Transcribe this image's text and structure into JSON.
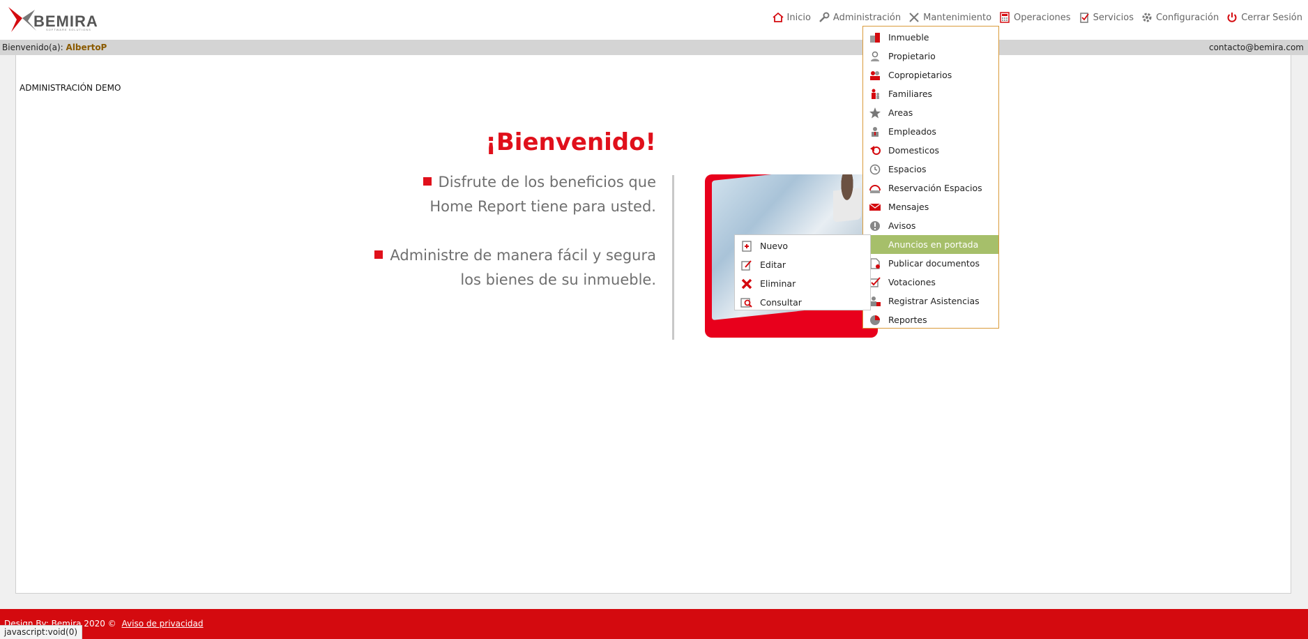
{
  "header": {
    "logo_text": "BEMIRA",
    "logo_sub": "SOFTWARE SOLUTIONS",
    "nav": [
      {
        "label": "Inicio",
        "icon": "home-icon"
      },
      {
        "label": "Administración",
        "icon": "wrench-icon"
      },
      {
        "label": "Mantenimiento",
        "icon": "tools-icon"
      },
      {
        "label": "Operaciones",
        "icon": "calculator-icon"
      },
      {
        "label": "Servicios",
        "icon": "clipboard-icon"
      },
      {
        "label": "Configuración",
        "icon": "gear-icon"
      },
      {
        "label": "Cerrar Sesión",
        "icon": "power-icon"
      }
    ]
  },
  "welcome_bar": {
    "prefix": "Bienvenido(a):",
    "user": "AlbertoP",
    "email": "contacto@bemira.com"
  },
  "content": {
    "admin_title": "ADMINISTRACIÓN DEMO",
    "heading": "¡Bienvenido!",
    "text1_line1": "Disfrute de los beneficios que",
    "text1_line2": "Home Report tiene para usted.",
    "text2_line1": "Administre de manera fácil y segura",
    "text2_line2": "los bienes de su inmueble."
  },
  "dropdown": {
    "items": [
      {
        "label": "Inmueble",
        "icon": "building-icon"
      },
      {
        "label": "Propietario",
        "icon": "owner-icon"
      },
      {
        "label": "Copropietarios",
        "icon": "co-owners-icon"
      },
      {
        "label": "Familiares",
        "icon": "family-icon"
      },
      {
        "label": "Areas",
        "icon": "star-icon"
      },
      {
        "label": "Empleados",
        "icon": "employee-icon"
      },
      {
        "label": "Domesticos",
        "icon": "domestic-icon"
      },
      {
        "label": "Espacios",
        "icon": "clock-icon"
      },
      {
        "label": "Reservación Espacios",
        "icon": "reservation-icon"
      },
      {
        "label": "Mensajes",
        "icon": "envelope-icon"
      },
      {
        "label": "Avisos",
        "icon": "alert-icon"
      },
      {
        "label": "Anuncios en portada",
        "icon": "announcement-icon"
      },
      {
        "label": "Publicar documentos",
        "icon": "document-icon"
      },
      {
        "label": "Votaciones",
        "icon": "checkbox-icon"
      },
      {
        "label": "Registrar Asistencias",
        "icon": "attendance-icon"
      },
      {
        "label": "Reportes",
        "icon": "pie-chart-icon"
      }
    ],
    "active_index": 11
  },
  "submenu": {
    "items": [
      {
        "label": "Nuevo",
        "icon": "new-icon"
      },
      {
        "label": "Editar",
        "icon": "edit-icon"
      },
      {
        "label": "Eliminar",
        "icon": "delete-icon"
      },
      {
        "label": "Consultar",
        "icon": "search-icon"
      }
    ]
  },
  "footer": {
    "text": "Design By: Bemira 2020 ©",
    "privacy": "Aviso de privacidad"
  },
  "status_tip": "javascript:void(0)",
  "colors": {
    "brand_red": "#d40a0f",
    "heading_red": "#e0101b",
    "menu_border": "#d99a3a",
    "menu_active": "#a6bf6a"
  }
}
